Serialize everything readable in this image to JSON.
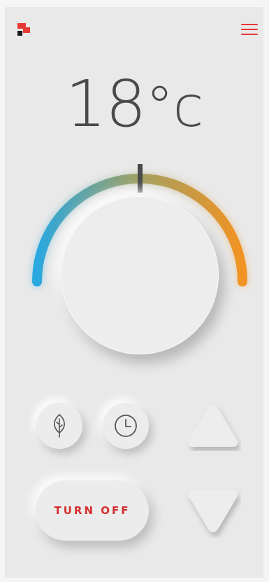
{
  "header": {
    "logo_icon": "brand-logo-icon",
    "menu_icon": "hamburger-menu-icon"
  },
  "thermostat": {
    "temperature": "18",
    "unit": "°c",
    "range_gradient_colors": [
      "#29a8e0",
      "#c9a34a",
      "#f29323"
    ],
    "indicator_color": "#4a4a4a"
  },
  "controls": {
    "eco_icon": "leaf-icon",
    "timer_icon": "clock-icon",
    "increase_icon": "triangle-up-icon",
    "decrease_icon": "triangle-down-icon",
    "turn_off_label": "TURN OFF"
  },
  "colors": {
    "accent": "#e53935",
    "background": "#e9e9e9",
    "text": "#4a4a4a"
  }
}
